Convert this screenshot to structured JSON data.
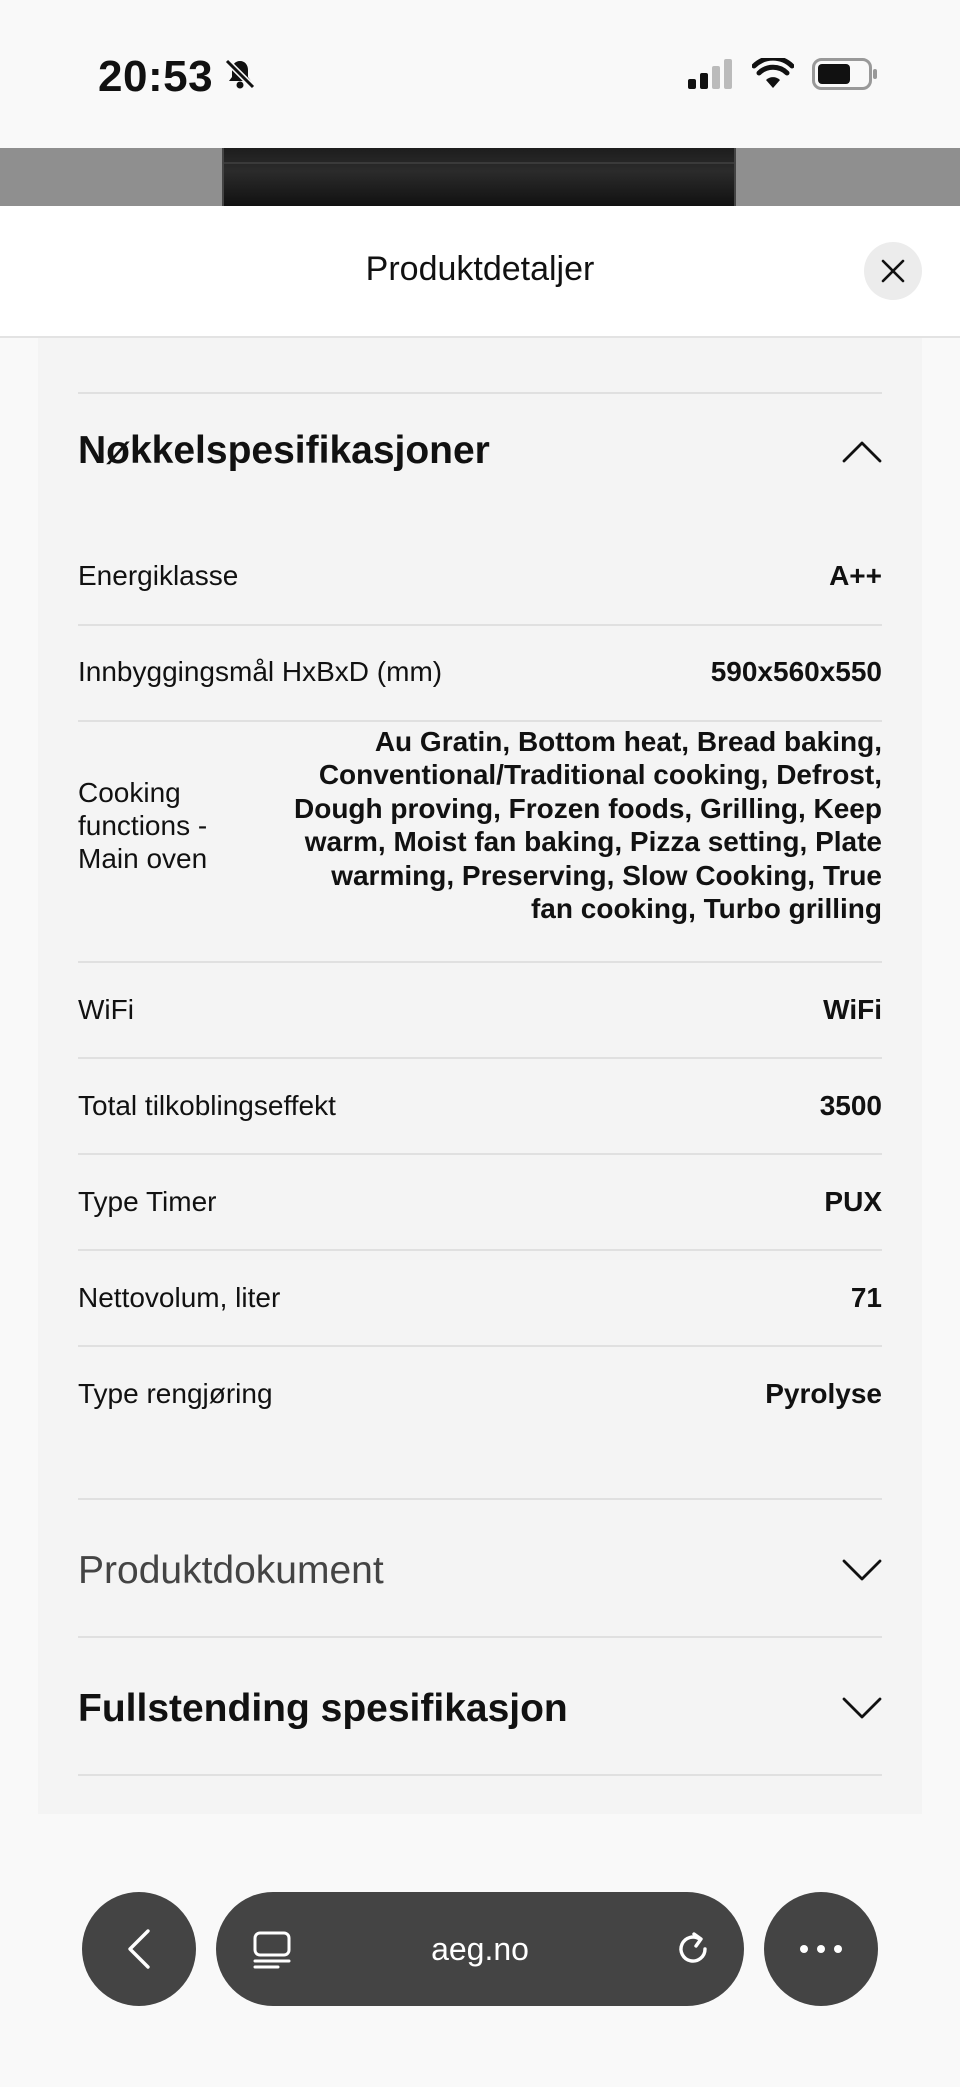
{
  "status_bar": {
    "time": "20:53"
  },
  "header": {
    "title": "Produktdetaljer"
  },
  "key_specs": {
    "title": "Nøkkelspesifikasjoner",
    "rows": [
      {
        "label": "Energiklasse",
        "value": "A++"
      },
      {
        "label": "Innbyggingsmål HxBxD (mm)",
        "value": "590x560x550"
      },
      {
        "label": "Cooking functions - Main oven",
        "value": "Au Gratin, Bottom heat, Bread baking, Conventional/Traditional cooking, Defrost, Dough proving, Frozen foods, Grilling, Keep warm, Moist fan baking, Pizza setting, Plate warming, Preserving, Slow Cooking, True fan cooking, Turbo grilling"
      },
      {
        "label": "WiFi",
        "value": "WiFi"
      },
      {
        "label": "Total tilkoblingseffekt",
        "value": "3500"
      },
      {
        "label": "Type Timer",
        "value": "PUX"
      },
      {
        "label": "Nettovolum, liter",
        "value": "71"
      },
      {
        "label": "Type rengjøring",
        "value": "Pyrolyse"
      }
    ]
  },
  "sections": {
    "documents": "Produktdokument",
    "full_spec": "Fullstending spesifikasjon"
  },
  "browser": {
    "url": "aeg.no"
  }
}
